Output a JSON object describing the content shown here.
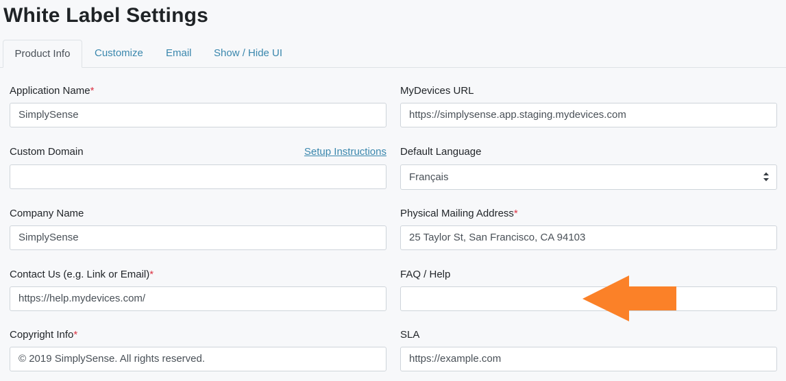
{
  "page": {
    "title": "White Label Settings"
  },
  "tabs": [
    {
      "label": "Product Info"
    },
    {
      "label": "Customize"
    },
    {
      "label": "Email"
    },
    {
      "label": "Show / Hide UI"
    }
  ],
  "fields": {
    "application_name": {
      "label": "Application Name",
      "value": "SimplySense"
    },
    "mydevices_url": {
      "label": "MyDevices URL",
      "value": "https://simplysense.app.staging.mydevices.com"
    },
    "custom_domain": {
      "label": "Custom Domain",
      "value": "",
      "link": "Setup Instructions"
    },
    "default_language": {
      "label": "Default Language",
      "value": "Français"
    },
    "company_name": {
      "label": "Company Name",
      "value": "SimplySense"
    },
    "physical_address": {
      "label": "Physical Mailing Address",
      "value": "25 Taylor St, San Francisco, CA 94103"
    },
    "contact_us": {
      "label": "Contact Us (e.g. Link or Email)",
      "value": "https://help.mydevices.com/"
    },
    "faq_help": {
      "label": "FAQ / Help",
      "value": ""
    },
    "copyright": {
      "label": "Copyright Info",
      "value": "© 2019 SimplySense. All rights reserved."
    },
    "sla": {
      "label": "SLA",
      "value": "https://example.com"
    }
  },
  "required_marker": "*",
  "colors": {
    "accent_link": "#3a87ad",
    "required": "#dc3545",
    "annotation_arrow": "#fb8128"
  },
  "annotation": {
    "icon": "left-arrow-icon"
  }
}
